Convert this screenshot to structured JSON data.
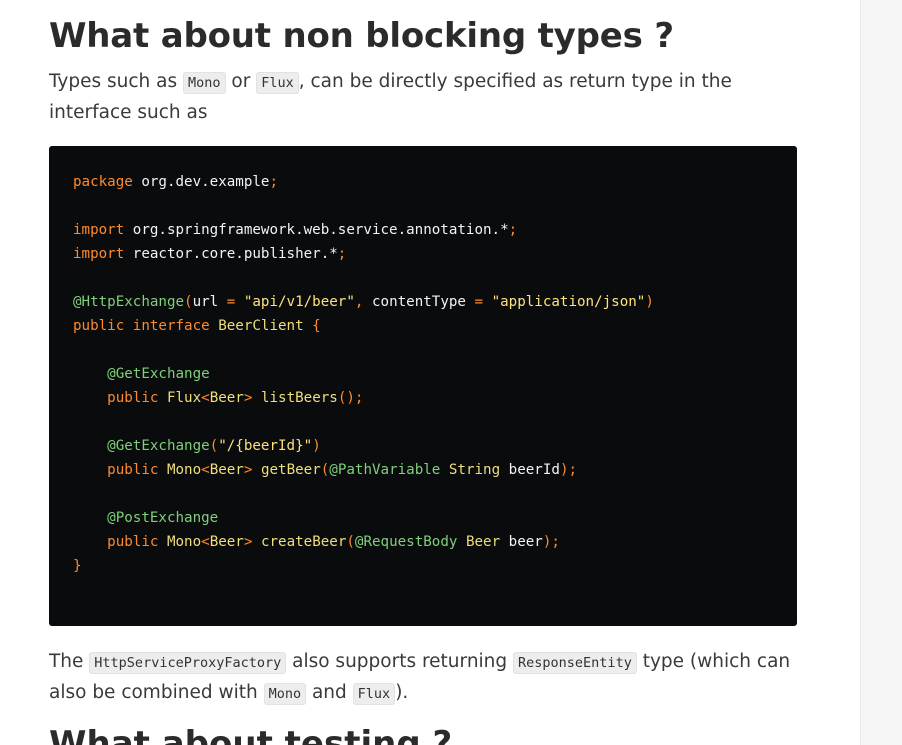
{
  "heading": "What about non blocking types ?",
  "intro": {
    "before": "Types such as ",
    "code1": "Mono",
    "mid": " or ",
    "code2": "Flux",
    "after": ", can be directly specified as return type in the interface such as"
  },
  "code": {
    "lines": [
      [
        {
          "t": "package",
          "c": "kw"
        },
        {
          "t": " org.dev.example",
          "c": "idn"
        },
        {
          "t": ";",
          "c": "pun"
        }
      ],
      [],
      [
        {
          "t": "import",
          "c": "kw"
        },
        {
          "t": " org.springframework.web.service.annotation.*",
          "c": "idn"
        },
        {
          "t": ";",
          "c": "pun"
        }
      ],
      [
        {
          "t": "import",
          "c": "kw"
        },
        {
          "t": " reactor.core.publisher.*",
          "c": "idn"
        },
        {
          "t": ";",
          "c": "pun"
        }
      ],
      [],
      [
        {
          "t": "@HttpExchange",
          "c": "ann"
        },
        {
          "t": "(",
          "c": "pun"
        },
        {
          "t": "url",
          "c": "idn"
        },
        {
          "t": " = ",
          "c": "pun"
        },
        {
          "t": "\"api/v1/beer\"",
          "c": "str"
        },
        {
          "t": ", ",
          "c": "pun"
        },
        {
          "t": "contentType",
          "c": "idn"
        },
        {
          "t": " = ",
          "c": "pun"
        },
        {
          "t": "\"application/json\"",
          "c": "str"
        },
        {
          "t": ")",
          "c": "pun"
        }
      ],
      [
        {
          "t": "public",
          "c": "kw"
        },
        {
          "t": " ",
          "c": "idn"
        },
        {
          "t": "interface",
          "c": "kw"
        },
        {
          "t": " BeerClient",
          "c": "typ"
        },
        {
          "t": " {",
          "c": "pun"
        }
      ],
      [],
      [
        {
          "t": "    @GetExchange",
          "c": "ann"
        }
      ],
      [
        {
          "t": "    public",
          "c": "kw"
        },
        {
          "t": " Flux",
          "c": "typ"
        },
        {
          "t": "<",
          "c": "pun"
        },
        {
          "t": "Beer",
          "c": "typ"
        },
        {
          "t": ">",
          "c": "pun"
        },
        {
          "t": " listBeers",
          "c": "fn"
        },
        {
          "t": "();",
          "c": "pun"
        }
      ],
      [],
      [
        {
          "t": "    @GetExchange",
          "c": "ann"
        },
        {
          "t": "(",
          "c": "pun"
        },
        {
          "t": "\"/{beerId}\"",
          "c": "str"
        },
        {
          "t": ")",
          "c": "pun"
        }
      ],
      [
        {
          "t": "    public",
          "c": "kw"
        },
        {
          "t": " Mono",
          "c": "typ"
        },
        {
          "t": "<",
          "c": "pun"
        },
        {
          "t": "Beer",
          "c": "typ"
        },
        {
          "t": ">",
          "c": "pun"
        },
        {
          "t": " getBeer",
          "c": "fn"
        },
        {
          "t": "(",
          "c": "pun"
        },
        {
          "t": "@PathVariable",
          "c": "ann"
        },
        {
          "t": " String",
          "c": "typ"
        },
        {
          "t": " beerId",
          "c": "idn"
        },
        {
          "t": ");",
          "c": "pun"
        }
      ],
      [],
      [
        {
          "t": "    @PostExchange",
          "c": "ann"
        }
      ],
      [
        {
          "t": "    public",
          "c": "kw"
        },
        {
          "t": " Mono",
          "c": "typ"
        },
        {
          "t": "<",
          "c": "pun"
        },
        {
          "t": "Beer",
          "c": "typ"
        },
        {
          "t": ">",
          "c": "pun"
        },
        {
          "t": " createBeer",
          "c": "fn"
        },
        {
          "t": "(",
          "c": "pun"
        },
        {
          "t": "@RequestBody",
          "c": "ann"
        },
        {
          "t": " Beer",
          "c": "typ"
        },
        {
          "t": " beer",
          "c": "idn"
        },
        {
          "t": ");",
          "c": "pun"
        }
      ],
      [
        {
          "t": "}",
          "c": "pun"
        }
      ]
    ]
  },
  "outro": {
    "before": "The ",
    "code1": "HttpServiceProxyFactory",
    "mid1": " also supports returning ",
    "code2": "ResponseEntity",
    "mid2": " type (which can also be combined with ",
    "code3": "Mono",
    "mid3": " and ",
    "code4": "Flux",
    "after": ")."
  },
  "next_heading": "What about testing ?"
}
